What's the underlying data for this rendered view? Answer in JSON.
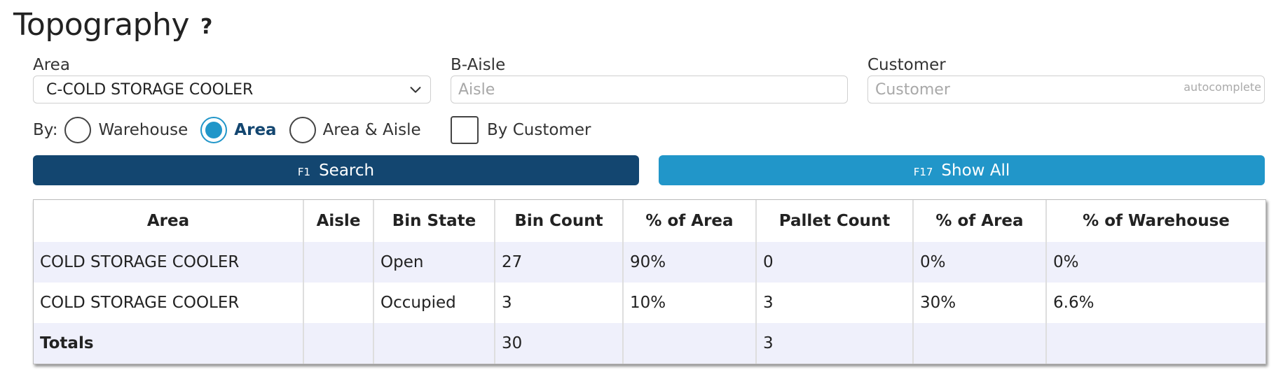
{
  "page": {
    "title": "Topography",
    "help_label": "?"
  },
  "filters": {
    "area": {
      "label": "Area",
      "value": "C-COLD STORAGE COOLER"
    },
    "aisle": {
      "label": "B-Aisle",
      "placeholder": "Aisle",
      "value": ""
    },
    "customer": {
      "label": "Customer",
      "placeholder": "Customer",
      "value": "",
      "hint": "autocomplete"
    }
  },
  "by": {
    "label": "By:",
    "options": [
      {
        "label": "Warehouse",
        "checked": false
      },
      {
        "label": "Area",
        "checked": true
      },
      {
        "label": "Area & Aisle",
        "checked": false
      }
    ],
    "by_customer": {
      "label": "By Customer",
      "checked": false
    }
  },
  "buttons": {
    "search": {
      "key": "F1",
      "label": "Search",
      "color": "#134670"
    },
    "show_all": {
      "key": "F17",
      "label": "Show All",
      "color": "#2196c9"
    }
  },
  "table": {
    "headers": [
      "Area",
      "Aisle",
      "Bin State",
      "Bin Count",
      "% of Area",
      "Pallet Count",
      "% of Area",
      "% of Warehouse"
    ],
    "rows": [
      [
        "COLD STORAGE COOLER",
        "",
        "Open",
        "27",
        "90%",
        "0",
        "0%",
        "0%"
      ],
      [
        "COLD STORAGE COOLER",
        "",
        "Occupied",
        "3",
        "10%",
        "3",
        "30%",
        "6.6%"
      ]
    ],
    "totals": [
      "Totals",
      "",
      "",
      "30",
      "",
      "3",
      "",
      ""
    ]
  },
  "icons": {
    "help": "question-icon",
    "select": "chevron-down-icon"
  }
}
